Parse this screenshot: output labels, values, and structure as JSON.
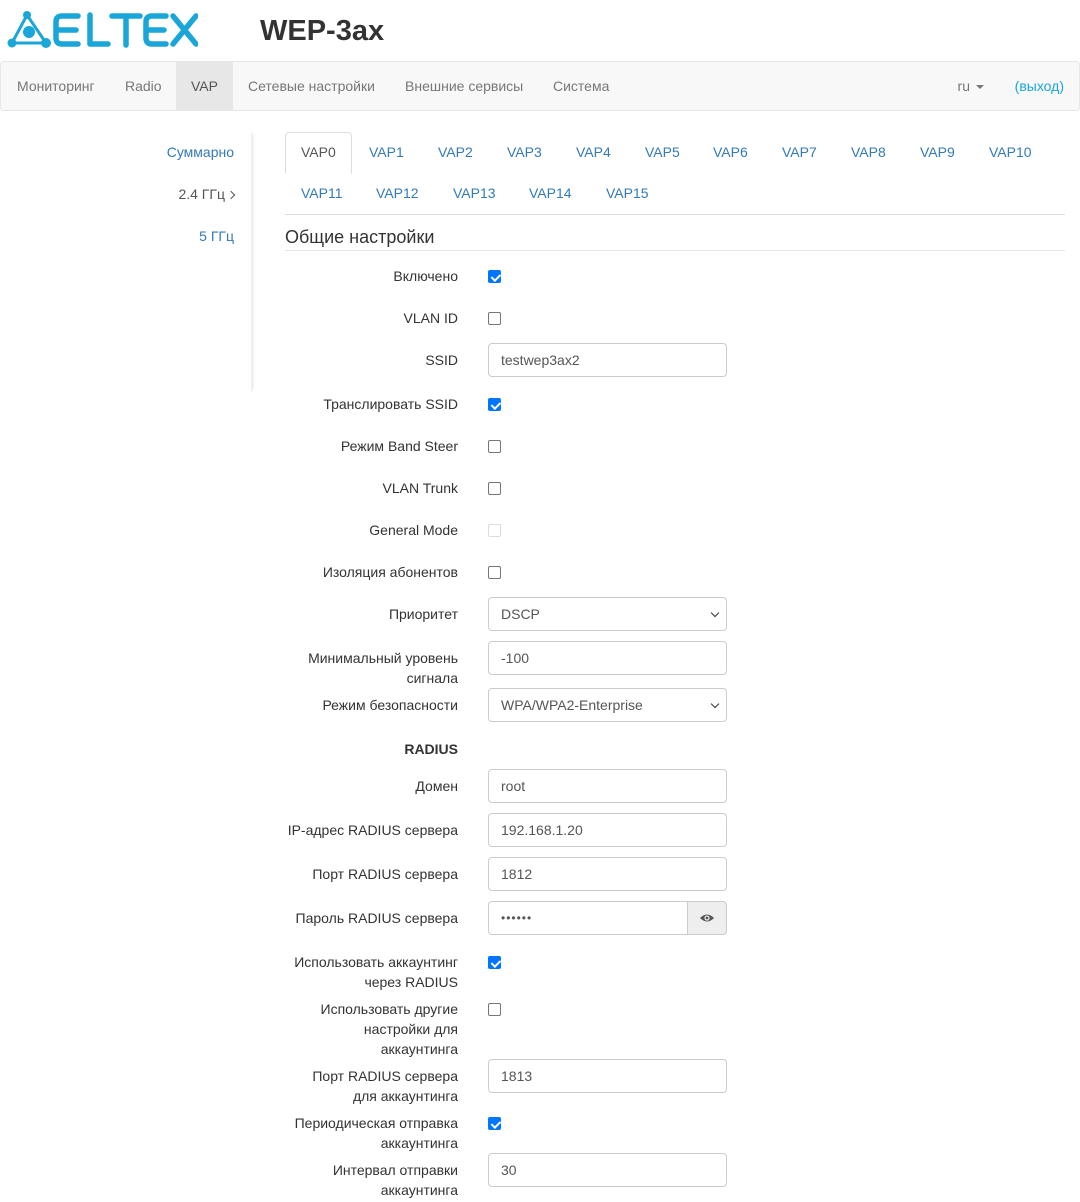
{
  "brand": {
    "logo_text": "ELTEX",
    "logo_color": "#1aa6d9"
  },
  "device": {
    "title": "WEP-3ax"
  },
  "nav": {
    "items": [
      {
        "label": "Мониторинг"
      },
      {
        "label": "Radio"
      },
      {
        "label": "VAP",
        "active": true
      },
      {
        "label": "Сетевые настройки"
      },
      {
        "label": "Внешние сервисы"
      },
      {
        "label": "Система"
      }
    ],
    "language": "ru",
    "logout": "(выход)"
  },
  "sidebar": {
    "items": [
      {
        "label": "Суммарно"
      },
      {
        "label": "2.4 ГГц"
      },
      {
        "label": "5 ГГц"
      }
    ]
  },
  "tabs": {
    "items": [
      "VAP0",
      "VAP1",
      "VAP2",
      "VAP3",
      "VAP4",
      "VAP5",
      "VAP6",
      "VAP7",
      "VAP8",
      "VAP9",
      "VAP10",
      "VAP11",
      "VAP12",
      "VAP13",
      "VAP14",
      "VAP15"
    ],
    "active": "VAP0"
  },
  "section": {
    "title": "Общие настройки"
  },
  "form": {
    "enabled": {
      "label": "Включено",
      "checked": true
    },
    "vlan_id": {
      "label": "VLAN ID",
      "checked": false
    },
    "ssid": {
      "label": "SSID",
      "value": "testwep3ax2"
    },
    "broadcast_ssid": {
      "label": "Транслировать SSID",
      "checked": true
    },
    "band_steer": {
      "label": "Режим Band Steer",
      "checked": false
    },
    "vlan_trunk": {
      "label": "VLAN Trunk",
      "checked": false
    },
    "general_mode": {
      "label": "General Mode",
      "checked": false,
      "disabled": true
    },
    "client_isolation": {
      "label": "Изоляция абонентов",
      "checked": false
    },
    "priority": {
      "label": "Приоритет",
      "value": "DSCP"
    },
    "min_signal": {
      "label_line1": "Минимальный уровень",
      "label_line2": "сигнала",
      "value": "-100"
    },
    "security_mode": {
      "label": "Режим безопасности",
      "value": "WPA/WPA2-Enterprise"
    },
    "radius_header": "RADIUS",
    "domain": {
      "label": "Домен",
      "value": "root"
    },
    "radius_ip": {
      "label": "IP-адрес RADIUS сервера",
      "value": "192.168.1.20"
    },
    "radius_port": {
      "label": "Порт RADIUS сервера",
      "value": "1812"
    },
    "radius_password": {
      "label": "Пароль RADIUS сервера",
      "value": "••••••"
    },
    "accounting": {
      "label_line1": "Использовать аккаунтинг",
      "label_line2": "через RADIUS",
      "checked": true
    },
    "other_accounting": {
      "label_line1": "Использовать другие",
      "label_line2": "настройки для",
      "label_line3": "аккаунтинга",
      "checked": false
    },
    "acct_port": {
      "label_line1": "Порт RADIUS сервера",
      "label_line2": "для аккаунтинга",
      "value": "1813"
    },
    "periodic_acct": {
      "label_line1": "Периодическая отправка",
      "label_line2": "аккаунтинга",
      "checked": true
    },
    "acct_interval": {
      "label_line1": "Интервал отправки",
      "label_line2": "аккаунтинга",
      "value": "30"
    }
  }
}
